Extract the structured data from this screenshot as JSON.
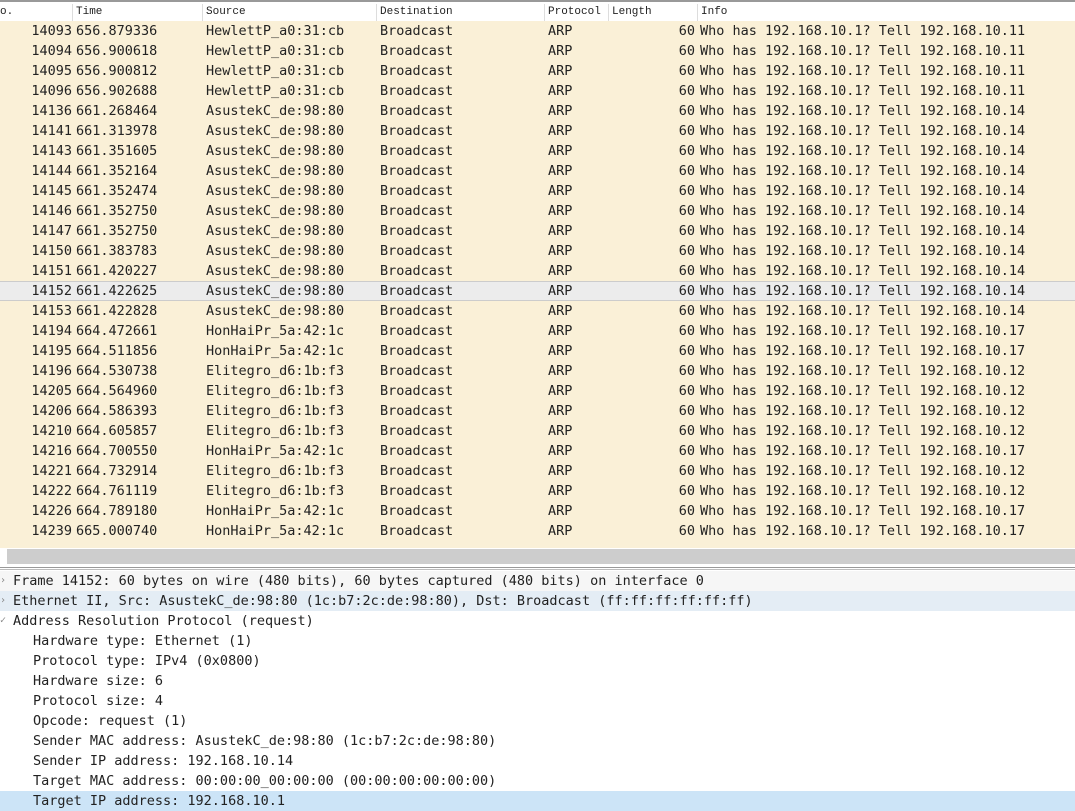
{
  "columns": {
    "no": "o.",
    "time": "Time",
    "source": "Source",
    "destination": "Destination",
    "protocol": "Protocol",
    "length": "Length",
    "info": "Info"
  },
  "packets": [
    [
      "14093",
      "656.879336",
      "HewlettP_a0:31:cb",
      "Broadcast",
      "ARP",
      "60",
      "Who has 192.168.10.1? Tell 192.168.10.11"
    ],
    [
      "14094",
      "656.900618",
      "HewlettP_a0:31:cb",
      "Broadcast",
      "ARP",
      "60",
      "Who has 192.168.10.1? Tell 192.168.10.11"
    ],
    [
      "14095",
      "656.900812",
      "HewlettP_a0:31:cb",
      "Broadcast",
      "ARP",
      "60",
      "Who has 192.168.10.1? Tell 192.168.10.11"
    ],
    [
      "14096",
      "656.902688",
      "HewlettP_a0:31:cb",
      "Broadcast",
      "ARP",
      "60",
      "Who has 192.168.10.1? Tell 192.168.10.11"
    ],
    [
      "14136",
      "661.268464",
      "AsustekC_de:98:80",
      "Broadcast",
      "ARP",
      "60",
      "Who has 192.168.10.1? Tell 192.168.10.14"
    ],
    [
      "14141",
      "661.313978",
      "AsustekC_de:98:80",
      "Broadcast",
      "ARP",
      "60",
      "Who has 192.168.10.1? Tell 192.168.10.14"
    ],
    [
      "14143",
      "661.351605",
      "AsustekC_de:98:80",
      "Broadcast",
      "ARP",
      "60",
      "Who has 192.168.10.1? Tell 192.168.10.14"
    ],
    [
      "14144",
      "661.352164",
      "AsustekC_de:98:80",
      "Broadcast",
      "ARP",
      "60",
      "Who has 192.168.10.1? Tell 192.168.10.14"
    ],
    [
      "14145",
      "661.352474",
      "AsustekC_de:98:80",
      "Broadcast",
      "ARP",
      "60",
      "Who has 192.168.10.1? Tell 192.168.10.14"
    ],
    [
      "14146",
      "661.352750",
      "AsustekC_de:98:80",
      "Broadcast",
      "ARP",
      "60",
      "Who has 192.168.10.1? Tell 192.168.10.14"
    ],
    [
      "14147",
      "661.352750",
      "AsustekC_de:98:80",
      "Broadcast",
      "ARP",
      "60",
      "Who has 192.168.10.1? Tell 192.168.10.14"
    ],
    [
      "14150",
      "661.383783",
      "AsustekC_de:98:80",
      "Broadcast",
      "ARP",
      "60",
      "Who has 192.168.10.1? Tell 192.168.10.14"
    ],
    [
      "14151",
      "661.420227",
      "AsustekC_de:98:80",
      "Broadcast",
      "ARP",
      "60",
      "Who has 192.168.10.1? Tell 192.168.10.14"
    ],
    [
      "14152",
      "661.422625",
      "AsustekC_de:98:80",
      "Broadcast",
      "ARP",
      "60",
      "Who has 192.168.10.1? Tell 192.168.10.14"
    ],
    [
      "14153",
      "661.422828",
      "AsustekC_de:98:80",
      "Broadcast",
      "ARP",
      "60",
      "Who has 192.168.10.1? Tell 192.168.10.14"
    ],
    [
      "14194",
      "664.472661",
      "HonHaiPr_5a:42:1c",
      "Broadcast",
      "ARP",
      "60",
      "Who has 192.168.10.1? Tell 192.168.10.17"
    ],
    [
      "14195",
      "664.511856",
      "HonHaiPr_5a:42:1c",
      "Broadcast",
      "ARP",
      "60",
      "Who has 192.168.10.1? Tell 192.168.10.17"
    ],
    [
      "14196",
      "664.530738",
      "Elitegro_d6:1b:f3",
      "Broadcast",
      "ARP",
      "60",
      "Who has 192.168.10.1? Tell 192.168.10.12"
    ],
    [
      "14205",
      "664.564960",
      "Elitegro_d6:1b:f3",
      "Broadcast",
      "ARP",
      "60",
      "Who has 192.168.10.1? Tell 192.168.10.12"
    ],
    [
      "14206",
      "664.586393",
      "Elitegro_d6:1b:f3",
      "Broadcast",
      "ARP",
      "60",
      "Who has 192.168.10.1? Tell 192.168.10.12"
    ],
    [
      "14210",
      "664.605857",
      "Elitegro_d6:1b:f3",
      "Broadcast",
      "ARP",
      "60",
      "Who has 192.168.10.1? Tell 192.168.10.12"
    ],
    [
      "14216",
      "664.700550",
      "HonHaiPr_5a:42:1c",
      "Broadcast",
      "ARP",
      "60",
      "Who has 192.168.10.1? Tell 192.168.10.17"
    ],
    [
      "14221",
      "664.732914",
      "Elitegro_d6:1b:f3",
      "Broadcast",
      "ARP",
      "60",
      "Who has 192.168.10.1? Tell 192.168.10.12"
    ],
    [
      "14222",
      "664.761119",
      "Elitegro_d6:1b:f3",
      "Broadcast",
      "ARP",
      "60",
      "Who has 192.168.10.1? Tell 192.168.10.12"
    ],
    [
      "14226",
      "664.789180",
      "HonHaiPr_5a:42:1c",
      "Broadcast",
      "ARP",
      "60",
      "Who has 192.168.10.1? Tell 192.168.10.17"
    ],
    [
      "14239",
      "665.000740",
      "HonHaiPr_5a:42:1c",
      "Broadcast",
      "ARP",
      "60",
      "Who has 192.168.10.1? Tell 192.168.10.17"
    ]
  ],
  "selected_packet": "14152",
  "details": [
    {
      "text": "Frame 14152: 60 bytes on wire (480 bits), 60 bytes captured (480 bits) on interface 0",
      "level": 0,
      "arrow": "›",
      "cls": "frame"
    },
    {
      "text": "Ethernet II, Src: AsustekC_de:98:80 (1c:b7:2c:de:98:80), Dst: Broadcast (ff:ff:ff:ff:ff:ff)",
      "level": 0,
      "arrow": "›",
      "cls": "hl"
    },
    {
      "text": "Address Resolution Protocol (request)",
      "level": 0,
      "arrow": "✓",
      "cls": ""
    },
    {
      "text": "Hardware type: Ethernet (1)",
      "level": 1,
      "cls": ""
    },
    {
      "text": "Protocol type: IPv4 (0x0800)",
      "level": 1,
      "cls": ""
    },
    {
      "text": "Hardware size: 6",
      "level": 1,
      "cls": ""
    },
    {
      "text": "Protocol size: 4",
      "level": 1,
      "cls": ""
    },
    {
      "text": "Opcode: request (1)",
      "level": 1,
      "cls": ""
    },
    {
      "text": "Sender MAC address: AsustekC_de:98:80 (1c:b7:2c:de:98:80)",
      "level": 1,
      "cls": ""
    },
    {
      "text": "Sender IP address: 192.168.10.14",
      "level": 1,
      "cls": ""
    },
    {
      "text": "Target MAC address: 00:00:00_00:00:00 (00:00:00:00:00:00)",
      "level": 1,
      "cls": ""
    },
    {
      "text": "Target IP address: 192.168.10.1",
      "level": 1,
      "cls": "sel"
    }
  ],
  "colors": {
    "arp_row": "#faf0d7",
    "selected_row": "#ececec",
    "selected_detail": "#cce4f7"
  }
}
